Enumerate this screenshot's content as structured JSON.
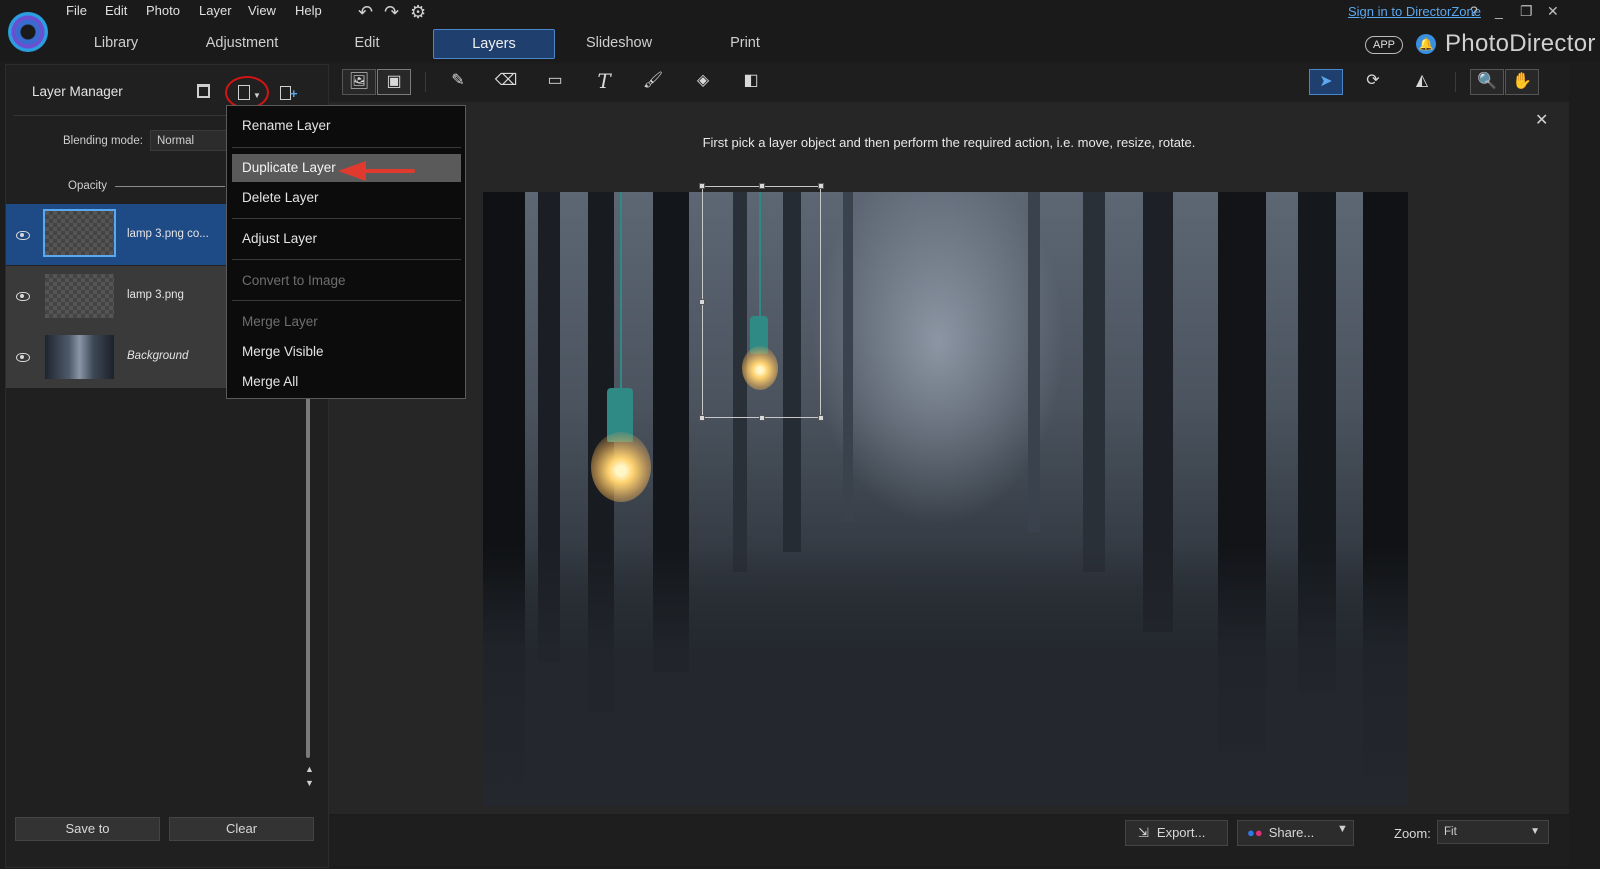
{
  "menu": [
    "File",
    "Edit",
    "Photo",
    "Layer",
    "View",
    "Help"
  ],
  "tabs": [
    "Library",
    "Adjustment",
    "Edit",
    "Layers",
    "Slideshow",
    "Print"
  ],
  "active_tab": "Layers",
  "header": {
    "signin": "Sign in to DirectorZone",
    "help": "?",
    "app_badge": "APP",
    "brand": "PhotoDirector"
  },
  "layer_manager": {
    "title": "Layer Manager",
    "blending_label": "Blending mode:",
    "blending_value": "Normal",
    "opacity_label": "Opacity",
    "layers": [
      {
        "name": "lamp 3.png co...",
        "selected": true
      },
      {
        "name": "lamp 3.png",
        "selected": false
      },
      {
        "name": "Background",
        "selected": false
      }
    ],
    "save_label": "Save to",
    "clear_label": "Clear"
  },
  "context_menu": {
    "items": [
      {
        "label": "Rename Layer",
        "disabled": false
      },
      {
        "label": "Duplicate Layer",
        "disabled": false,
        "highlighted": true
      },
      {
        "label": "Delete Layer",
        "disabled": false
      },
      {
        "label": "Adjust Layer",
        "disabled": false
      },
      {
        "label": "Convert to Image",
        "disabled": true
      },
      {
        "label": "Merge Layer",
        "disabled": true
      },
      {
        "label": "Merge Visible",
        "disabled": false
      },
      {
        "label": "Merge All",
        "disabled": false
      }
    ]
  },
  "info": {
    "message": "First pick a layer object and then perform the required action, i.e. move, resize, rotate."
  },
  "bottom": {
    "export_label": "Export...",
    "share_label": "Share...",
    "zoom_label": "Zoom:",
    "zoom_value": "Fit"
  },
  "colors": {
    "accent": "#4a86c8",
    "selected_layer": "#1e4b86",
    "annotation_red": "#e03a2e"
  }
}
